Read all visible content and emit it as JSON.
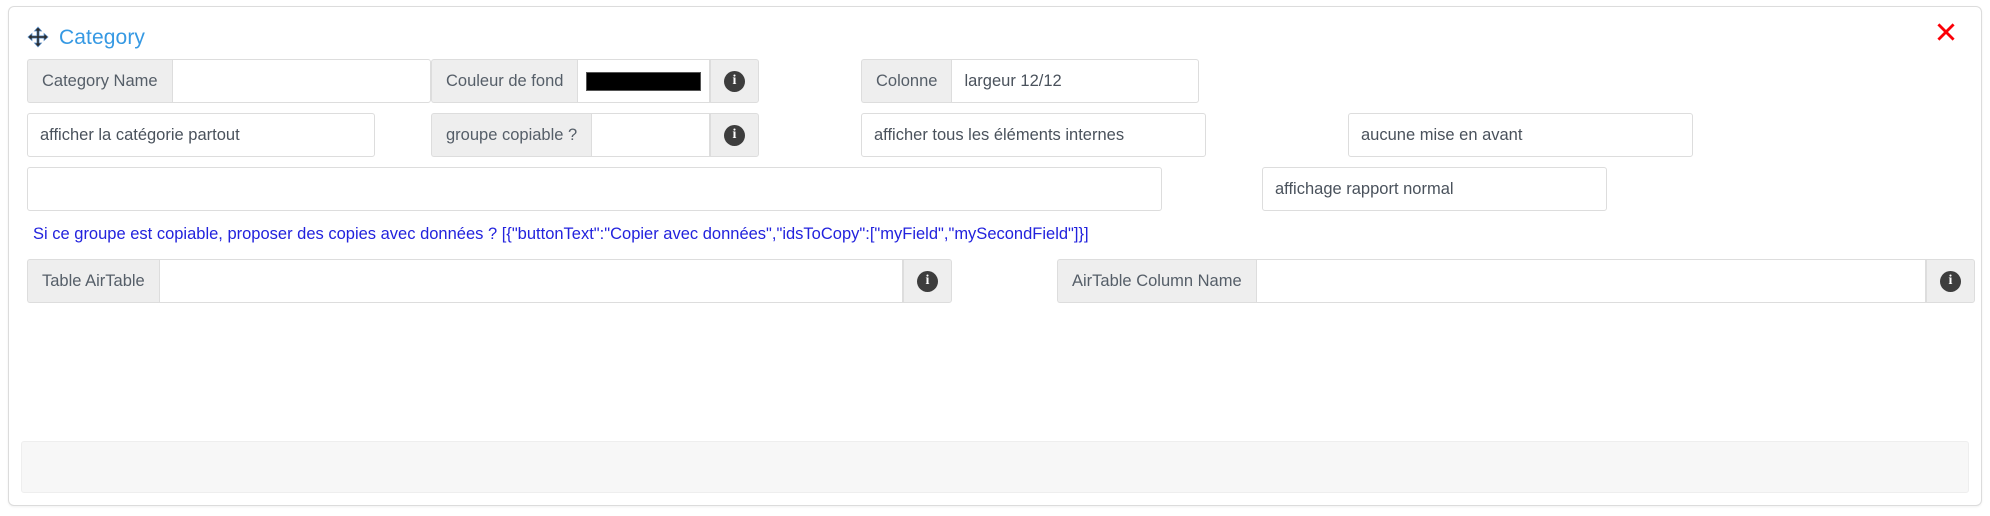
{
  "panel": {
    "title": "Category",
    "move_icon": "move-arrows-icon",
    "close_icon": "close-x-icon",
    "accent_color": "#3699e3",
    "close_color": "#ff0000"
  },
  "fields": {
    "category_name": {
      "label": "Category Name",
      "value": "",
      "placeholder": ""
    },
    "background_color": {
      "label": "Couleur de fond",
      "value": "#000000",
      "info_icon": "info-circle-icon"
    },
    "column": {
      "label": "Colonne",
      "value": "largeur 12/12"
    },
    "show_category": {
      "value": "afficher la catégorie partout"
    },
    "copyable_group": {
      "label": "groupe copiable ?",
      "value": "",
      "placeholder": "",
      "info_icon": "info-circle-icon"
    },
    "show_internal_elements": {
      "value": "afficher tous les éléments internes"
    },
    "highlight": {
      "value": "aucune mise en avant"
    },
    "copy_json": {
      "value": "",
      "placeholder": ""
    },
    "report_display": {
      "value": "affichage rapport normal"
    },
    "airtable_table": {
      "label": "Table AirTable",
      "value": "",
      "placeholder": "",
      "info_icon": "info-circle-icon"
    },
    "airtable_column": {
      "label": "AirTable Column Name",
      "value": "",
      "placeholder": "",
      "info_icon": "info-circle-icon"
    }
  },
  "help": {
    "copy_hint": "Si ce groupe est copiable, proposer des copies avec données ? [{\"buttonText\":\"Copier avec données\",\"idsToCopy\":[\"myField\",\"mySecondField\"]}]"
  }
}
